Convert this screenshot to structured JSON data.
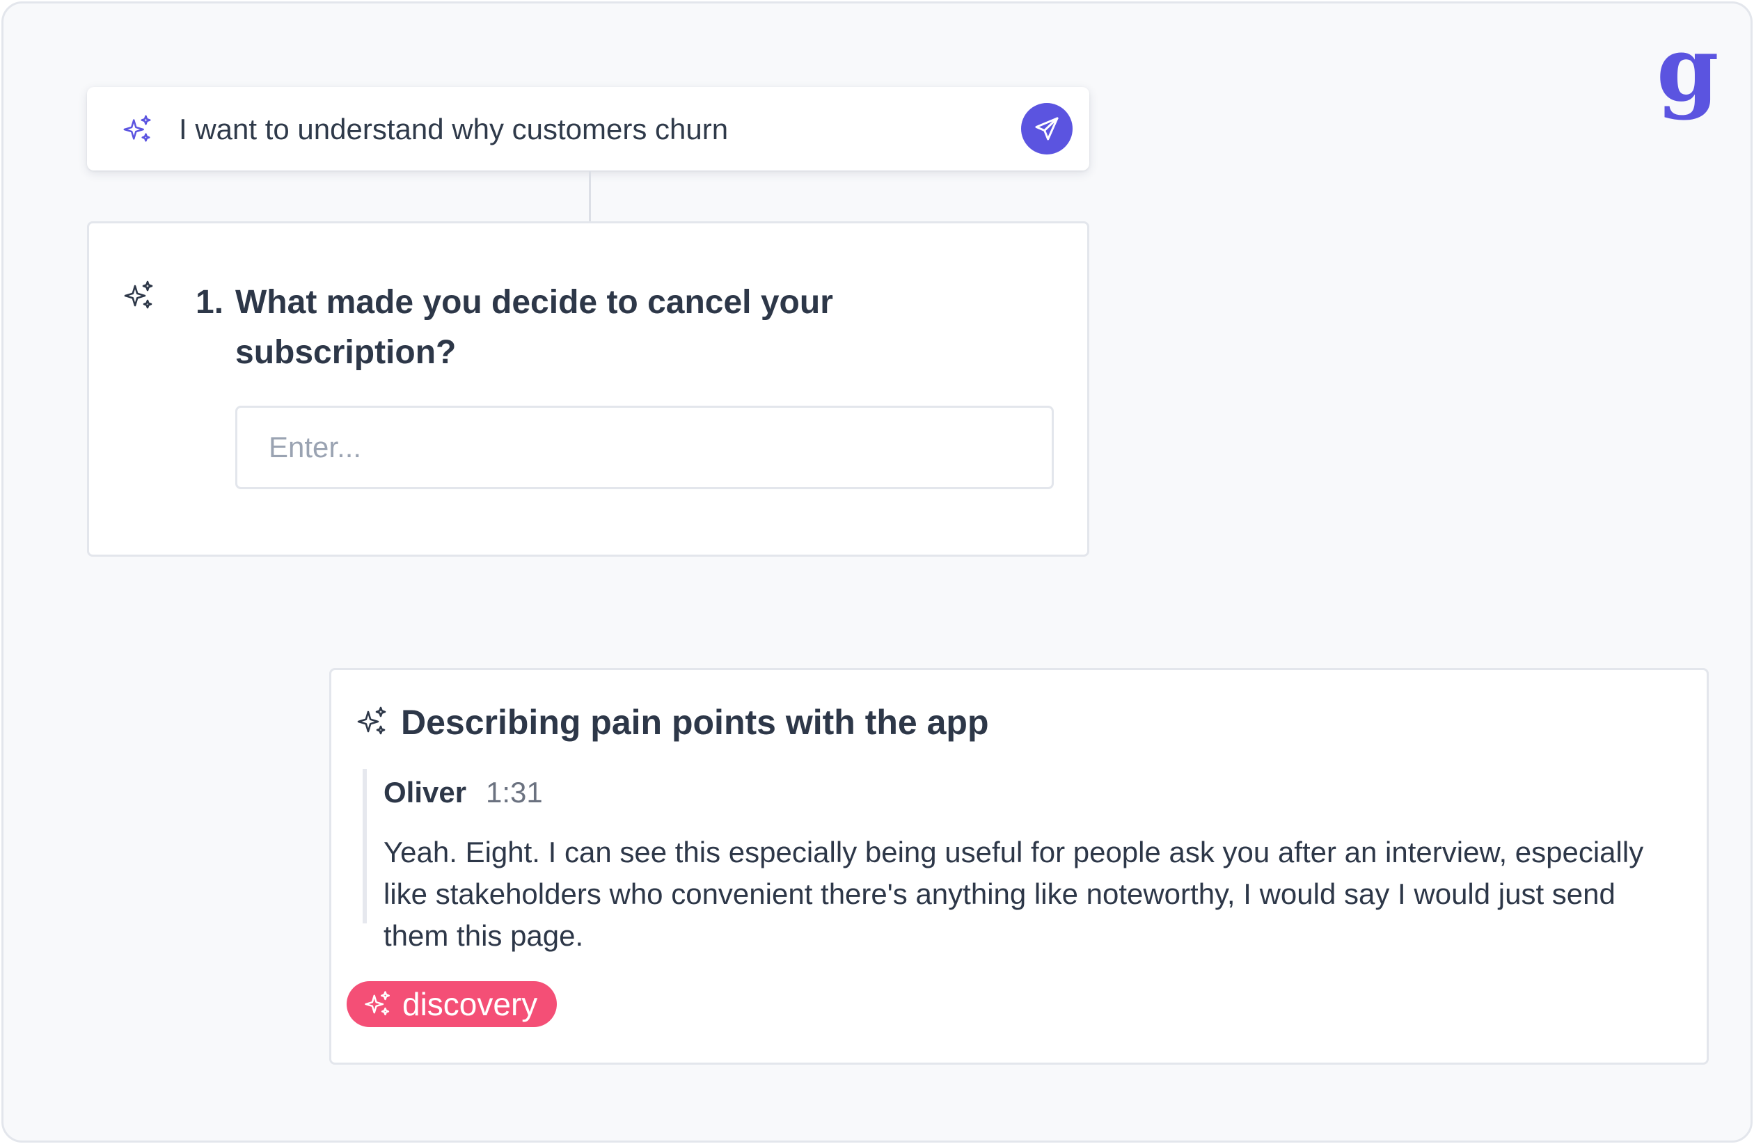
{
  "logo": {
    "glyph": "g",
    "color": "#5b54e0"
  },
  "prompt": {
    "icon": "sparkles-icon",
    "text": "I want to understand why customers churn",
    "send_icon": "paper-plane-icon",
    "accent": "#5b54e0"
  },
  "question": {
    "icon": "sparkles-icon",
    "number": "1.",
    "text": "What made you decide to cancel your subscription?",
    "input_placeholder": "Enter...",
    "input_value": ""
  },
  "insight": {
    "icon": "sparkles-icon",
    "title": "Describing pain points with the app",
    "author": "Oliver",
    "timestamp": "1:31",
    "quote": "Yeah. Eight. I can see this especially being useful for people ask you after an interview, especially like stakeholders who convenient there's anything like noteworthy, I would say I would just send them this page.",
    "tag": {
      "icon": "sparkles-icon",
      "label": "discovery",
      "color": "#f44f76"
    }
  }
}
